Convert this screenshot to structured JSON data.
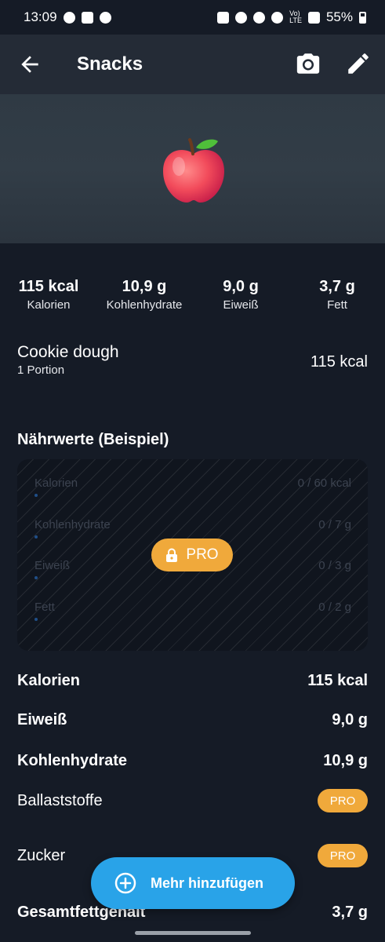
{
  "status_bar": {
    "time": "13:09",
    "lte_label": "Vo)\nLTE",
    "battery": "55%"
  },
  "app_bar": {
    "title": "Snacks",
    "icons": [
      "back-arrow-icon",
      "camera-icon",
      "pencil-icon"
    ]
  },
  "hero": {
    "image": "apple-icon"
  },
  "macros": [
    {
      "value": "115 kcal",
      "label": "Kalorien"
    },
    {
      "value": "10,9 g",
      "label": "Kohlenhydrate"
    },
    {
      "value": "9,0 g",
      "label": "Eiweiß"
    },
    {
      "value": "3,7 g",
      "label": "Fett"
    }
  ],
  "portion": {
    "name": "Cookie dough",
    "amount": "1 Portion",
    "kcal": "115 kcal"
  },
  "nutrition_section": {
    "title": "Nährwerte (Beispiel)",
    "locked_rows": [
      {
        "name": "Kalorien",
        "value": "0 / 60 kcal"
      },
      {
        "name": "Kohlenhydrate",
        "value": "0 / 7 g"
      },
      {
        "name": "Eiweiß",
        "value": "0 / 3 g"
      },
      {
        "name": "Fett",
        "value": "0 / 2 g"
      }
    ],
    "pro_label": "PRO"
  },
  "nutrients": [
    {
      "name": "Kalorien",
      "value": "115 kcal"
    },
    {
      "name": "Eiweiß",
      "value": "9,0 g"
    },
    {
      "name": "Kohlenhydrate",
      "value": "10,9 g"
    },
    {
      "name": "Ballaststoffe",
      "badge": "PRO"
    },
    {
      "name": "Zucker",
      "badge": "PRO"
    },
    {
      "name": "Gesamtfettgehalt",
      "value": "3,7 g"
    }
  ],
  "fab": {
    "label": "Mehr hinzufügen",
    "icon": "plus-circle-icon"
  },
  "colors": {
    "background": "#151b26",
    "app_bar": "#242b36",
    "pro_accent": "#f0a93b",
    "fab": "#29a3e8"
  }
}
